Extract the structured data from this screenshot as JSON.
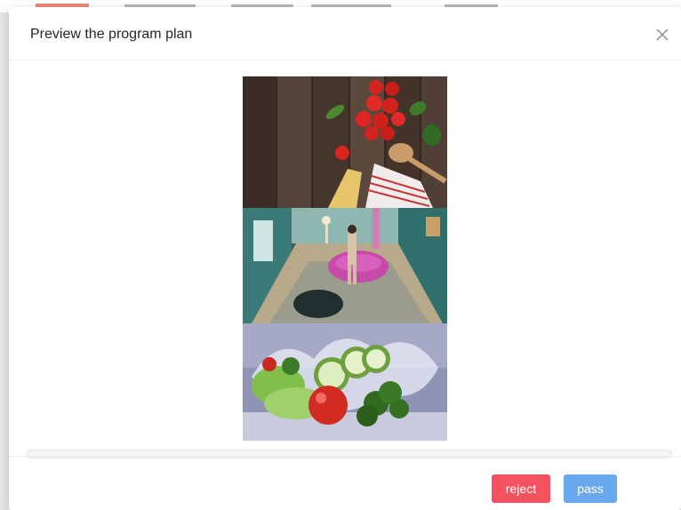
{
  "modal": {
    "title": "Preview the program plan",
    "close_icon": "close-icon"
  },
  "images": [
    {
      "name": "food-image",
      "alt": "",
      "icon": "photo-tomatoes-pasta"
    },
    {
      "name": "room-image",
      "alt": "",
      "icon": "photo-interior-room"
    },
    {
      "name": "salad-image",
      "alt": "",
      "icon": "photo-vegetables-splash"
    }
  ],
  "footer": {
    "reject_label": "reject",
    "pass_label": "pass"
  },
  "colors": {
    "reject": "#f5515f",
    "pass": "#69a7ee",
    "title": "#262626"
  }
}
